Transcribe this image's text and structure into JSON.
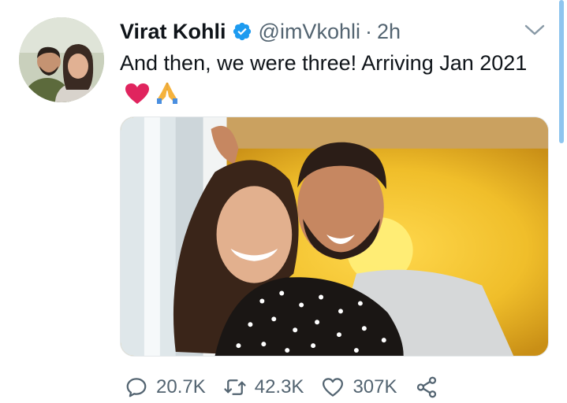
{
  "author": {
    "display_name": "Virat Kohli",
    "handle": "@imVkohli",
    "separator": "·",
    "timestamp": "2h",
    "verified": true
  },
  "tweet": {
    "text": "And then, we were three! Arriving Jan 2021",
    "emojis": [
      "red-heart-icon",
      "folded-hands-icon"
    ]
  },
  "actions": {
    "reply_count": "20.7K",
    "retweet_count": "42.3K",
    "like_count": "307K"
  },
  "colors": {
    "verified_badge": "#1d9bf0",
    "heart": "#e0245e",
    "secondary_text": "#536471",
    "scrollbar": "#8ec5ef"
  }
}
